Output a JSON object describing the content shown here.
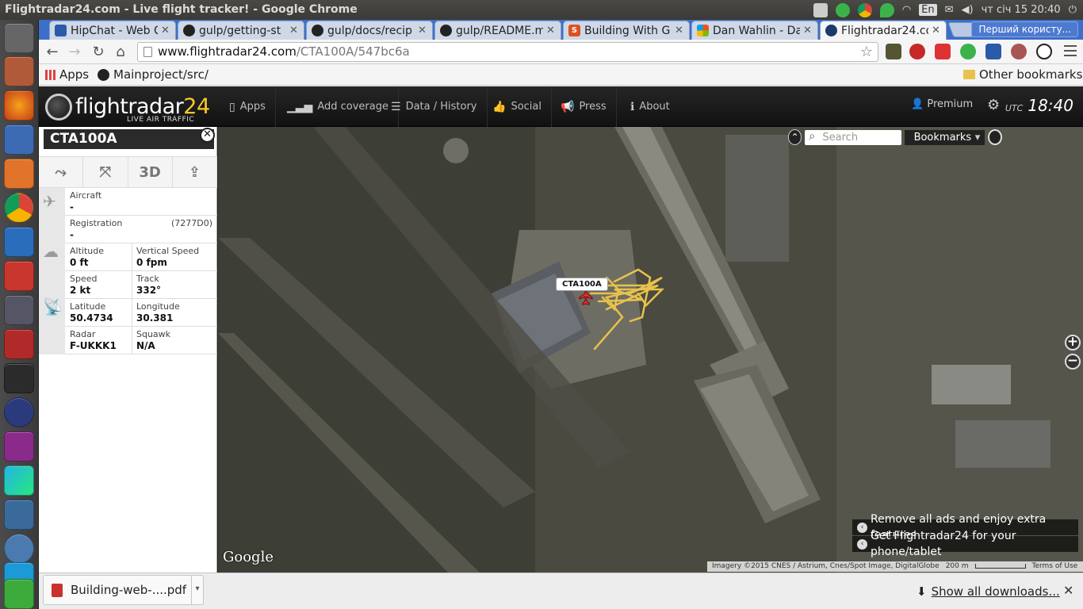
{
  "window": {
    "title": "Flightradar24.com - Live flight tracker! - Google Chrome"
  },
  "tray": {
    "keyboard_layout": "En",
    "datetime": "чт січ 15 20:40",
    "icons": [
      "keyboard-icon",
      "update-check-icon",
      "chrome-icon",
      "maps-pin-icon",
      "wifi-icon",
      "mail-icon",
      "volume-icon",
      "power-icon"
    ]
  },
  "launcher": {
    "apps": [
      "ubuntu-dash-icon",
      "file-manager-icon",
      "firefox-icon",
      "thunderbird-icon",
      "software-center-icon",
      "chrome-icon",
      "libreoffice-writer-icon",
      "system-settings-icon",
      "workspace-switcher-icon",
      "sd-card-icon",
      "terminal-icon",
      "app-icon",
      "app-icon-purple",
      "webstorm-icon",
      "system-monitor-icon",
      "quassel-icon",
      "skype-icon",
      "trash-icon"
    ]
  },
  "tabs": [
    {
      "label": "HipChat - Web C",
      "icon": "hipchat-icon"
    },
    {
      "label": "gulp/getting-st",
      "icon": "github-icon"
    },
    {
      "label": "gulp/docs/recip",
      "icon": "github-icon"
    },
    {
      "label": "gulp/README.m",
      "icon": "github-icon"
    },
    {
      "label": "Building With G",
      "icon": "scribd-icon"
    },
    {
      "label": "Dan Wahlin - Da",
      "icon": "windows-icon"
    },
    {
      "label": "Flightradar24.co",
      "icon": "flightradar-icon",
      "active": true
    }
  ],
  "profile": "Перший користу...",
  "address": {
    "host": "www.flightradar24.com",
    "path": "/CTA100A/547bc6a"
  },
  "bookmarks": {
    "apps": "Apps",
    "item1": "Mainproject/src/",
    "other": "Other bookmarks"
  },
  "fr24": {
    "logo_main": "flightradar",
    "logo_num": "24",
    "logo_sub": "LIVE AIR TRAFFIC",
    "nav": [
      {
        "label": "Apps",
        "icon": "mobile-icon"
      },
      {
        "label": "Add coverage",
        "icon": "signal-icon"
      },
      {
        "label": "Data / History",
        "icon": "database-icon"
      },
      {
        "label": "Social",
        "icon": "thumbs-up-icon"
      },
      {
        "label": "Press",
        "icon": "megaphone-icon"
      },
      {
        "label": "About",
        "icon": "info-icon"
      }
    ],
    "premium": "Premium",
    "utc_label": "UTC",
    "utc_time": "18:40"
  },
  "flight": {
    "callsign": "CTA100A",
    "aircraft_label": "Aircraft",
    "aircraft": "-",
    "registration_label": "Registration",
    "registration": "-",
    "hex": "(7277D0)",
    "altitude_label": "Altitude",
    "altitude": "0 ft",
    "vspeed_label": "Vertical Speed",
    "vspeed": "0 fpm",
    "speed_label": "Speed",
    "speed": "2 kt",
    "track_label": "Track",
    "track": "332°",
    "lat_label": "Latitude",
    "lat": "50.4734",
    "lon_label": "Longitude",
    "lon": "30.381",
    "radar_label": "Radar",
    "radar": "F-UKKK1",
    "squawk_label": "Squawk",
    "squawk": "N/A",
    "btn_3d": "3D"
  },
  "map": {
    "search_placeholder": "Search",
    "bookmarks": "Bookmarks",
    "aircraft_label": "CTA100A",
    "promo1": "Remove all ads and enjoy extra features",
    "promo2": "Get Flightradar24 for your phone/tablet",
    "google": "Google",
    "imagery": "Imagery ©2015 CNES / Astrium, Cnes/Spot Image, DigitalGlobe",
    "scale": "200 m",
    "terms": "Terms of Use",
    "track_color": "#e8c24a"
  },
  "downloads": {
    "file": "Building-web-....pdf",
    "show_all": "Show all downloads..."
  }
}
